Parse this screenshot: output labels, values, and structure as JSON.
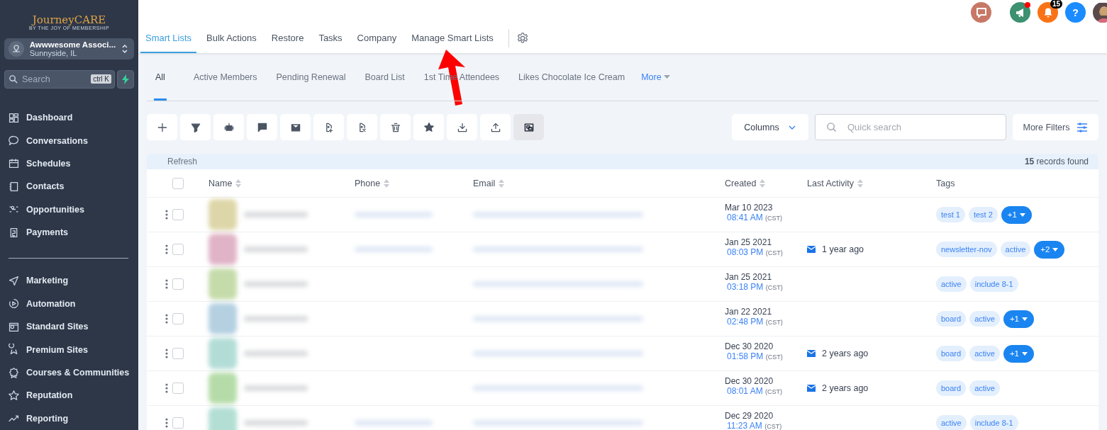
{
  "sidebar": {
    "logo": {
      "name": "JourneyCARE",
      "tagline": "BY THE JOY OF MEMBERSHIP"
    },
    "account": {
      "name": "Awwwesome Associ...",
      "location": "Sunnyside, IL"
    },
    "search": {
      "placeholder": "Search",
      "shortcut": "ctrl K"
    },
    "groups": [
      [
        "Dashboard",
        "Conversations",
        "Schedules",
        "Contacts",
        "Opportunities",
        "Payments"
      ],
      [
        "Marketing",
        "Automation",
        "Standard Sites",
        "Premium Sites",
        "Courses & Communities",
        "Reputation",
        "Reporting"
      ]
    ]
  },
  "header_icons": [
    {
      "kind": "chat",
      "dot": false
    },
    {
      "kind": "megaphone",
      "dot": true
    },
    {
      "kind": "bell",
      "dot": false,
      "badge": "15"
    },
    {
      "kind": "help",
      "dot": false,
      "label": "?"
    },
    {
      "kind": "avatar",
      "dot": false
    }
  ],
  "tabs": [
    {
      "label": "Smart Lists",
      "selected": true
    },
    {
      "label": "Bulk Actions",
      "selected": false
    },
    {
      "label": "Restore",
      "selected": false
    },
    {
      "label": "Tasks",
      "selected": false
    },
    {
      "label": "Company",
      "selected": false
    },
    {
      "label": "Manage Smart Lists",
      "selected": false
    }
  ],
  "subtabs": [
    {
      "label": "All",
      "selected": true
    },
    {
      "label": "Active Members",
      "selected": false
    },
    {
      "label": "Pending Renewal",
      "selected": false
    },
    {
      "label": "Board List",
      "selected": false
    },
    {
      "label": "1st Time Attendees",
      "selected": false
    },
    {
      "label": "Likes Chocolate Ice Cream",
      "selected": false
    }
  ],
  "more_link": "More",
  "toolbar": [
    {
      "selected": false
    },
    {
      "selected": false
    },
    {
      "selected": false
    },
    {
      "selected": false
    },
    {
      "selected": false
    },
    {
      "selected": false
    },
    {
      "selected": false
    },
    {
      "selected": false
    },
    {
      "selected": false
    },
    {
      "selected": false
    },
    {
      "selected": false
    },
    {
      "selected": true
    }
  ],
  "columns_button": "Columns",
  "quick_search": {
    "placeholder": "Quick search"
  },
  "more_filters": "More Filters",
  "refresh": "Refresh",
  "records": {
    "count": "15",
    "text": "records found"
  },
  "table": {
    "columns": [
      "Name",
      "Phone",
      "Email",
      "Created",
      "Last Activity",
      "Tags"
    ],
    "all_checked": false,
    "rows": [
      {
        "color": "#d8cf9a",
        "checked": false,
        "has_phone": true,
        "date": "Mar 10 2023",
        "time": "08:41 AM",
        "tz": "(CST)",
        "activity": null,
        "tags": [
          {
            "kind": "tag",
            "label": "test 1"
          },
          {
            "kind": "tag",
            "label": "test 2"
          },
          {
            "kind": "more",
            "label": "+1"
          }
        ]
      },
      {
        "color": "#dba7bd",
        "checked": false,
        "has_phone": true,
        "date": "Jan 25 2021",
        "time": "08:03 PM",
        "tz": "(CST)",
        "activity": "1 year ago",
        "tags": [
          {
            "kind": "tag",
            "label": "newsletter-nov"
          },
          {
            "kind": "tag",
            "label": "active"
          },
          {
            "kind": "more",
            "label": "+2"
          }
        ]
      },
      {
        "color": "#bcd59c",
        "checked": false,
        "has_phone": false,
        "date": "Jan 25 2021",
        "time": "03:18 PM",
        "tz": "(CST)",
        "activity": null,
        "tags": [
          {
            "kind": "tag",
            "label": "active"
          },
          {
            "kind": "tag",
            "label": "include 8-1"
          }
        ]
      },
      {
        "color": "#a7c8dc",
        "checked": false,
        "has_phone": false,
        "date": "Jan 22 2021",
        "time": "02:48 PM",
        "tz": "(CST)",
        "activity": null,
        "tags": [
          {
            "kind": "tag",
            "label": "board"
          },
          {
            "kind": "tag",
            "label": "active"
          },
          {
            "kind": "more",
            "label": "+1"
          }
        ]
      },
      {
        "color": "#a6d7d0",
        "checked": false,
        "has_phone": false,
        "date": "Dec 30 2020",
        "time": "01:58 PM",
        "tz": "(CST)",
        "activity": "2 years ago",
        "tags": [
          {
            "kind": "tag",
            "label": "board"
          },
          {
            "kind": "tag",
            "label": "active"
          },
          {
            "kind": "more",
            "label": "+1"
          }
        ]
      },
      {
        "color": "#a9d69a",
        "checked": false,
        "has_phone": false,
        "date": "Dec 30 2020",
        "time": "08:01 AM",
        "tz": "(CST)",
        "activity": "2 years ago",
        "tags": [
          {
            "kind": "tag",
            "label": "board"
          },
          {
            "kind": "tag",
            "label": "active"
          }
        ]
      },
      {
        "color": "#a6d9cc",
        "checked": false,
        "has_phone": true,
        "date": "Dec 29 2020",
        "time": "11:23 AM",
        "tz": "(CST)",
        "activity": null,
        "tags": [
          {
            "kind": "tag",
            "label": "active"
          },
          {
            "kind": "tag",
            "label": "include 8-1"
          }
        ]
      }
    ]
  },
  "annotation": {
    "kind": "arrow"
  }
}
